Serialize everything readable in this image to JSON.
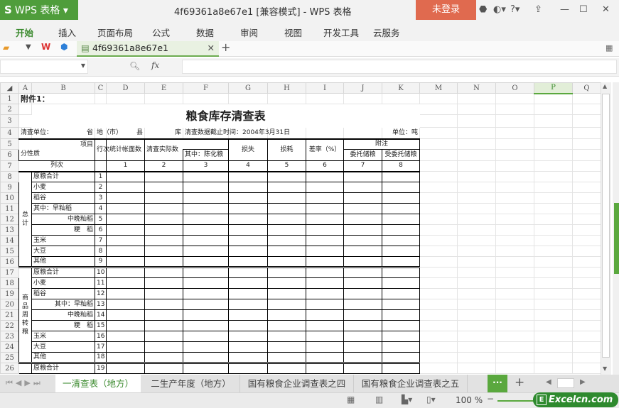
{
  "app": {
    "logo": "WPS 表格",
    "title": "4f69361a8e67e1 [兼容模式] - WPS 表格",
    "login": "未登录"
  },
  "menu": [
    "开始",
    "插入",
    "页面布局",
    "公式",
    "数据",
    "审阅",
    "视图",
    "开发工具",
    "云服务"
  ],
  "doc_tab": "4f69361a8e67e1",
  "formula": {
    "fx": "fx",
    "name_box": "",
    "value": ""
  },
  "columns": [
    "A",
    "B",
    "C",
    "D",
    "E",
    "F",
    "G",
    "H",
    "I",
    "J",
    "K",
    "M",
    "N",
    "O",
    "P",
    "Q"
  ],
  "selected_column": "P",
  "cells": {
    "A1": "附件1：",
    "title": "粮食库存清查表",
    "A4": "清查单位：",
    "B4": "省",
    "C4": "地（市）",
    "D4": "县",
    "E4": "库",
    "F4": "清查数据截止时间：2004年3月31日",
    "K4": "单位：吨",
    "A5_top": "项目",
    "A5_bottom": "分性质",
    "C5": "行次",
    "D5": "统计帐面数",
    "E5": "清查实际数",
    "F6": "其中：陈化粮",
    "G5": "损失",
    "H5": "损耗",
    "I5": "差率（%）",
    "J5": "附注",
    "J6": "委托储粮",
    "K6": "受委托储粮",
    "A7": "列次",
    "col_nums": [
      "1",
      "2",
      "3",
      "4",
      "5",
      "6",
      "7",
      "8"
    ],
    "group1": "总计",
    "group2": "商品周转粮",
    "block1": [
      "原粮合计",
      "小麦",
      "稻谷",
      "其中：早籼稻",
      "中晚籼稻",
      "粳　稻",
      "玉米",
      "大豆",
      "其他"
    ],
    "block2": [
      "原粮合计",
      "小麦",
      "稻谷",
      "其中：早籼稻",
      "中晚籼稻",
      "粳　稻",
      "玉米",
      "大豆",
      "其他"
    ],
    "row26": "原粮合计",
    "line_nums": [
      "1",
      "2",
      "3",
      "4",
      "5",
      "6",
      "7",
      "8",
      "9",
      "10",
      "11",
      "12",
      "13",
      "14",
      "15",
      "16",
      "17",
      "18",
      "19"
    ]
  },
  "sheets": [
    "一清查表（地方）",
    "二生产年度（地方）",
    "国有粮食企业调查表之四",
    "国有粮食企业调查表之五"
  ],
  "active_sheet": 0,
  "status": {
    "zoom": "100 %",
    "watermark": "Excelcn.com"
  },
  "colors": {
    "accent": "#4f9d3b",
    "login": "#e06a4f"
  }
}
